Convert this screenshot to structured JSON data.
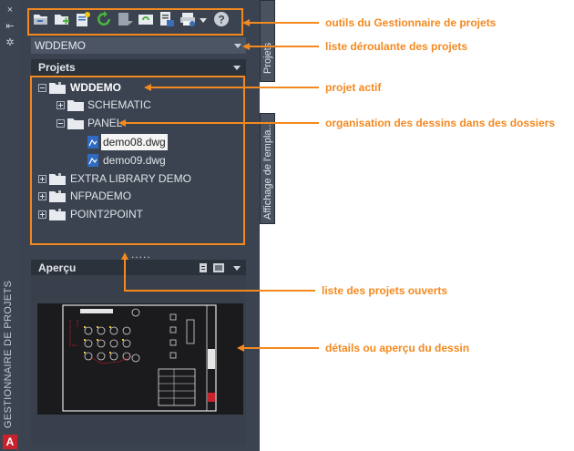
{
  "window": {
    "title": "GESTIONNAIRE DE PROJETS",
    "app_icon_letter": "A"
  },
  "toolbar": {
    "icons": [
      "open-project-icon",
      "new-project-icon",
      "new-drawing-icon",
      "refresh-icon",
      "task-list-icon",
      "project-wide-update-icon",
      "project-manager-icon",
      "publish-icon",
      "dropdown-icon",
      "help-icon"
    ]
  },
  "project_select": {
    "selected": "WDDEMO"
  },
  "projects_panel": {
    "header": "Projets"
  },
  "tree": {
    "active_project": "WDDEMO",
    "folder_schematic": "SCHEMATIC",
    "folder_panel": "PANEL",
    "file_1": "demo08.dwg",
    "file_2": "demo09.dwg",
    "project_2": "EXTRA LIBRARY DEMO",
    "project_3": "NFPADEMO",
    "project_4": "POINT2POINT"
  },
  "splitter": {
    "grip": "....."
  },
  "preview_panel": {
    "header": "Aperçu"
  },
  "side_tabs": {
    "projets": "Projets",
    "emplacement": "Affichage de l'empla..."
  },
  "callouts": {
    "toolbar": "outils du Gestionnaire de projets",
    "project_list": "liste déroulante des projets",
    "active_project": "projet actif",
    "organisation": "organisation des dessins dans des dossiers",
    "open_projects": "liste des projets ouverts",
    "preview": "détails ou aperçu du dessin"
  },
  "colors": {
    "panel_bg": "#3b4350",
    "callout_orange": "#f4891f",
    "selection_bg": "#f4f4f4"
  }
}
